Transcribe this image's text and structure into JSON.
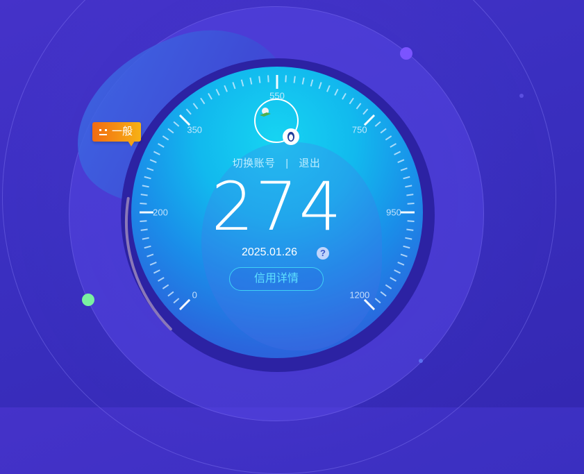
{
  "colors": {
    "background": "#3a2fc0",
    "dial_top": "#16d4f2",
    "dial_bottom": "#3152d6",
    "badge_start": "#f26b12",
    "badge_end": "#f7b214",
    "button_border": "#3fd2f5",
    "dot_purple": "#7b54ff",
    "dot_green": "#7af0a0"
  },
  "gauge": {
    "labels": [
      "0",
      "200",
      "350",
      "550",
      "750",
      "950",
      "1200"
    ],
    "score": "274",
    "progress_fraction": 0.2
  },
  "level_badge": {
    "label": "一般",
    "icon": "neutral-face-icon"
  },
  "account": {
    "switch_label": "切换账号",
    "separator": "|",
    "logout_label": "退出"
  },
  "date": "2025.01.26",
  "help_icon": "?",
  "detail_button": "信用详情",
  "avatar": {
    "icon": "avatar-image",
    "badge_icon": "qq-penguin-icon"
  }
}
